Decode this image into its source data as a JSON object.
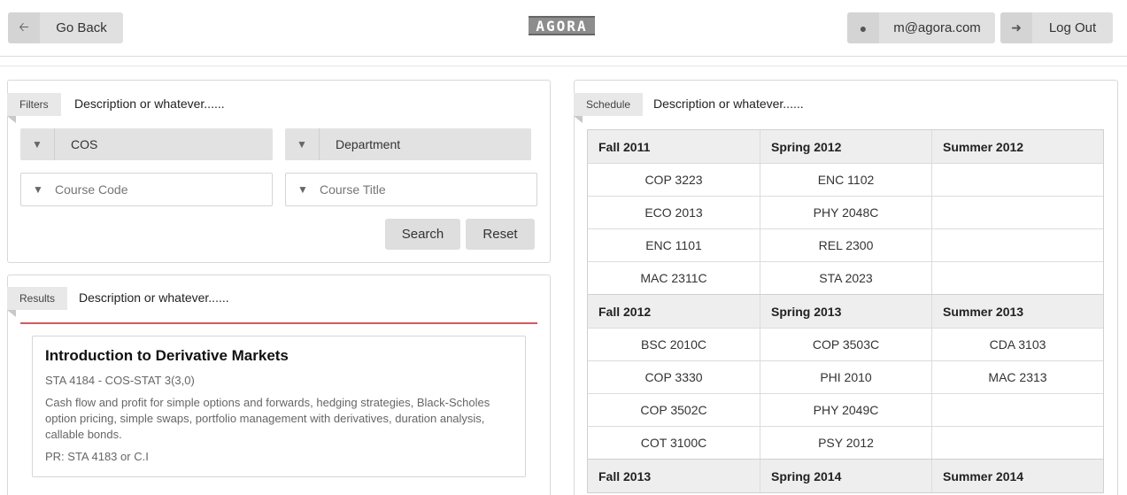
{
  "header": {
    "back_label": "Go Back",
    "logo_text": "AGORA",
    "user_email": "m@agora.com",
    "logout_label": "Log Out"
  },
  "filters": {
    "tag": "Filters",
    "description": "Description or whatever......",
    "subject_value": "COS",
    "department_value": "Department",
    "course_code_placeholder": "Course Code",
    "course_title_placeholder": "Course Title",
    "search_label": "Search",
    "reset_label": "Reset"
  },
  "results": {
    "tag": "Results",
    "description": "Description or whatever......",
    "items": [
      {
        "title": "Introduction to Derivative Markets",
        "sub": "STA 4184 - COS-STAT 3(3,0)",
        "desc": "Cash flow and profit for simple options and forwards, hedging strategies, Black-Scholes option pricing, simple swaps, portfolio management with derivatives, duration analysis, callable bonds.",
        "pr": "PR: STA 4183 or C.I"
      }
    ]
  },
  "schedule": {
    "tag": "Schedule",
    "description": "Description or whatever......",
    "blocks": [
      {
        "terms": [
          "Fall 2011",
          "Spring 2012",
          "Summer 2012"
        ],
        "rows": [
          [
            "COP 3223",
            "ENC 1102",
            ""
          ],
          [
            "ECO 2013",
            "PHY 2048C",
            ""
          ],
          [
            "ENC 1101",
            "REL 2300",
            ""
          ],
          [
            "MAC 2311C",
            "STA 2023",
            ""
          ]
        ]
      },
      {
        "terms": [
          "Fall 2012",
          "Spring 2013",
          "Summer 2013"
        ],
        "rows": [
          [
            "BSC 2010C",
            "COP 3503C",
            "CDA 3103"
          ],
          [
            "COP 3330",
            "PHI 2010",
            "MAC 2313"
          ],
          [
            "COP 3502C",
            "PHY 2049C",
            ""
          ],
          [
            "COT 3100C",
            "PSY 2012",
            ""
          ]
        ]
      },
      {
        "terms": [
          "Fall 2013",
          "Spring 2014",
          "Summer 2014"
        ],
        "rows": []
      }
    ]
  },
  "colors": {
    "accent_line": "#e05555",
    "button_bg": "#dedede"
  }
}
